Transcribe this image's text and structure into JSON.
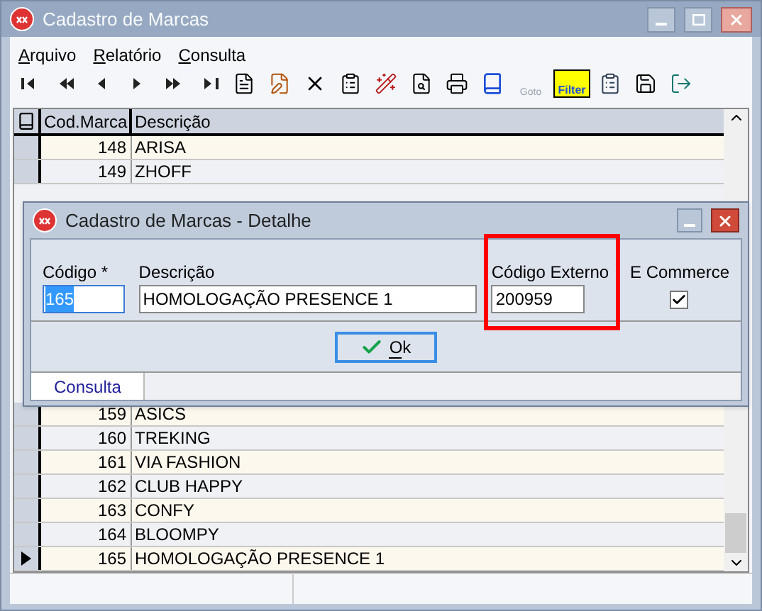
{
  "window": {
    "title": "Cadastro de Marcas"
  },
  "menu": [
    {
      "label": "Arquivo"
    },
    {
      "label": "Relatório"
    },
    {
      "label": "Consulta"
    }
  ],
  "toolbar": [
    {
      "kind": "first"
    },
    {
      "kind": "prev-page"
    },
    {
      "kind": "prev"
    },
    {
      "kind": "next"
    },
    {
      "kind": "next-page"
    },
    {
      "kind": "last"
    },
    {
      "kind": "new"
    },
    {
      "kind": "edit"
    },
    {
      "kind": "delete"
    },
    {
      "kind": "properties"
    },
    {
      "kind": "wand"
    },
    {
      "kind": "preview"
    },
    {
      "kind": "print"
    },
    {
      "kind": "book"
    },
    {
      "kind": "goto",
      "label": "Goto",
      "disabled": true
    },
    {
      "kind": "filter",
      "label": "Filter",
      "disabled": false
    },
    {
      "kind": "report"
    },
    {
      "kind": "save"
    },
    {
      "kind": "exit"
    }
  ],
  "table": {
    "columns": [
      "Cod.Marca",
      "Descrição"
    ],
    "rows_top": [
      {
        "code": "148",
        "name": "ARISA",
        "selected": false
      },
      {
        "code": "149",
        "name": "ZHOFF",
        "selected": false
      }
    ],
    "rows_bottom": [
      {
        "code": "159",
        "name": "ASICS",
        "selected": false
      },
      {
        "code": "160",
        "name": "TREKING",
        "selected": false
      },
      {
        "code": "161",
        "name": "VIA FASHION",
        "selected": false
      },
      {
        "code": "162",
        "name": "CLUB HAPPY",
        "selected": false
      },
      {
        "code": "163",
        "name": "CONFY",
        "selected": false
      },
      {
        "code": "164",
        "name": "BLOOMPY",
        "selected": false
      },
      {
        "code": "165",
        "name": "HOMOLOGAÇÃO PRESENCE 1",
        "selected": true
      }
    ]
  },
  "dialog": {
    "title": "Cadastro de Marcas - Detalhe",
    "fields": [
      {
        "label": "Código *",
        "value": "165"
      },
      {
        "label": "Descrição",
        "value": "HOMOLOGAÇÃO PRESENCE 1"
      },
      {
        "label": "Código Externo",
        "value": "200959"
      }
    ],
    "ecommerce": {
      "label": "E Commerce",
      "checked": true
    },
    "ok_button": "Ok",
    "tabs": [
      {
        "label": "Consulta",
        "selected": true
      }
    ]
  }
}
